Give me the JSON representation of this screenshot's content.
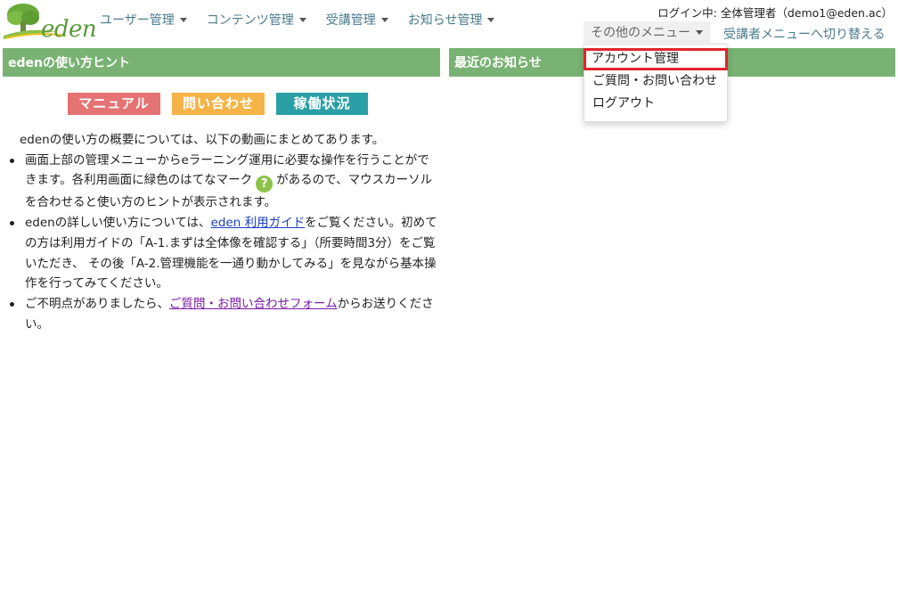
{
  "header": {
    "logo_text": "eden",
    "nav": [
      {
        "label": "ユーザー管理"
      },
      {
        "label": "コンテンツ管理"
      },
      {
        "label": "受講管理"
      },
      {
        "label": "お知らせ管理"
      }
    ],
    "login_info": "ログイン中: 全体管理者（demo1@eden.ac）",
    "other_menu_label": "その他のメニュー",
    "switch_menu_label": "受講者メニューへ切り替える"
  },
  "dropdown": {
    "items": [
      {
        "label": "アカウント管理"
      },
      {
        "label": "ご質問・お問い合わせ"
      },
      {
        "label": "ログアウト"
      }
    ]
  },
  "panels": {
    "left_title": "edenの使い方ヒント",
    "right_title": "最近のお知らせ"
  },
  "buttons": {
    "manual": "マニュアル",
    "contact": "問い合わせ",
    "status": "稼働状況"
  },
  "content": {
    "intro": "edenの使い方の概要については、以下の動画にまとめてあります。",
    "b1_part1": "画面上部の管理メニューからeラーニング運用に必要な操作を行うことができます。各利用画面に緑色のはてなマーク",
    "qmark": "?",
    "b1_part2": "があるので、マウスカーソルを合わせると使い方のヒントが表示されます。",
    "b2_part1": "edenの詳しい使い方については、",
    "b2_link": "eden 利用ガイド",
    "b2_part2": "をご覧ください。初めての方は利用ガイドの「A-1.まずは全体像を確認する」（所要時間3分）をご覧いただき、 その後「A-2.管理機能を一通り動かしてみる」を見ながら基本操作を行ってみてください。",
    "b3_part1": "ご不明点がありましたら、",
    "b3_link": "ご質問・お問い合わせフォーム",
    "b3_part2": "からお送りください。"
  }
}
